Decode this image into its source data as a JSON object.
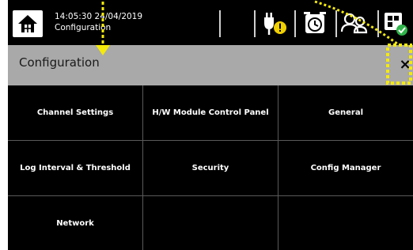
{
  "status": {
    "time": "14:05:30",
    "date": "24/04/2019",
    "screen": "Configuration",
    "icons": [
      "home-icon",
      "power-plug-warning-icon",
      "alarm-clock-icon",
      "user-switch-icon",
      "module-status-icon"
    ]
  },
  "header": {
    "title": "Configuration",
    "close_label": "×"
  },
  "grid": {
    "items": [
      "Channel Settings",
      "H/W Module Control Panel",
      "General",
      "Log Interval & Threshold",
      "Security",
      "Config Manager",
      "Network",
      "",
      ""
    ]
  },
  "colors": {
    "background": "#000000",
    "titlebar": "#a9a9a9",
    "annotation": "#f5ea0a",
    "warning": "#f0d000"
  }
}
